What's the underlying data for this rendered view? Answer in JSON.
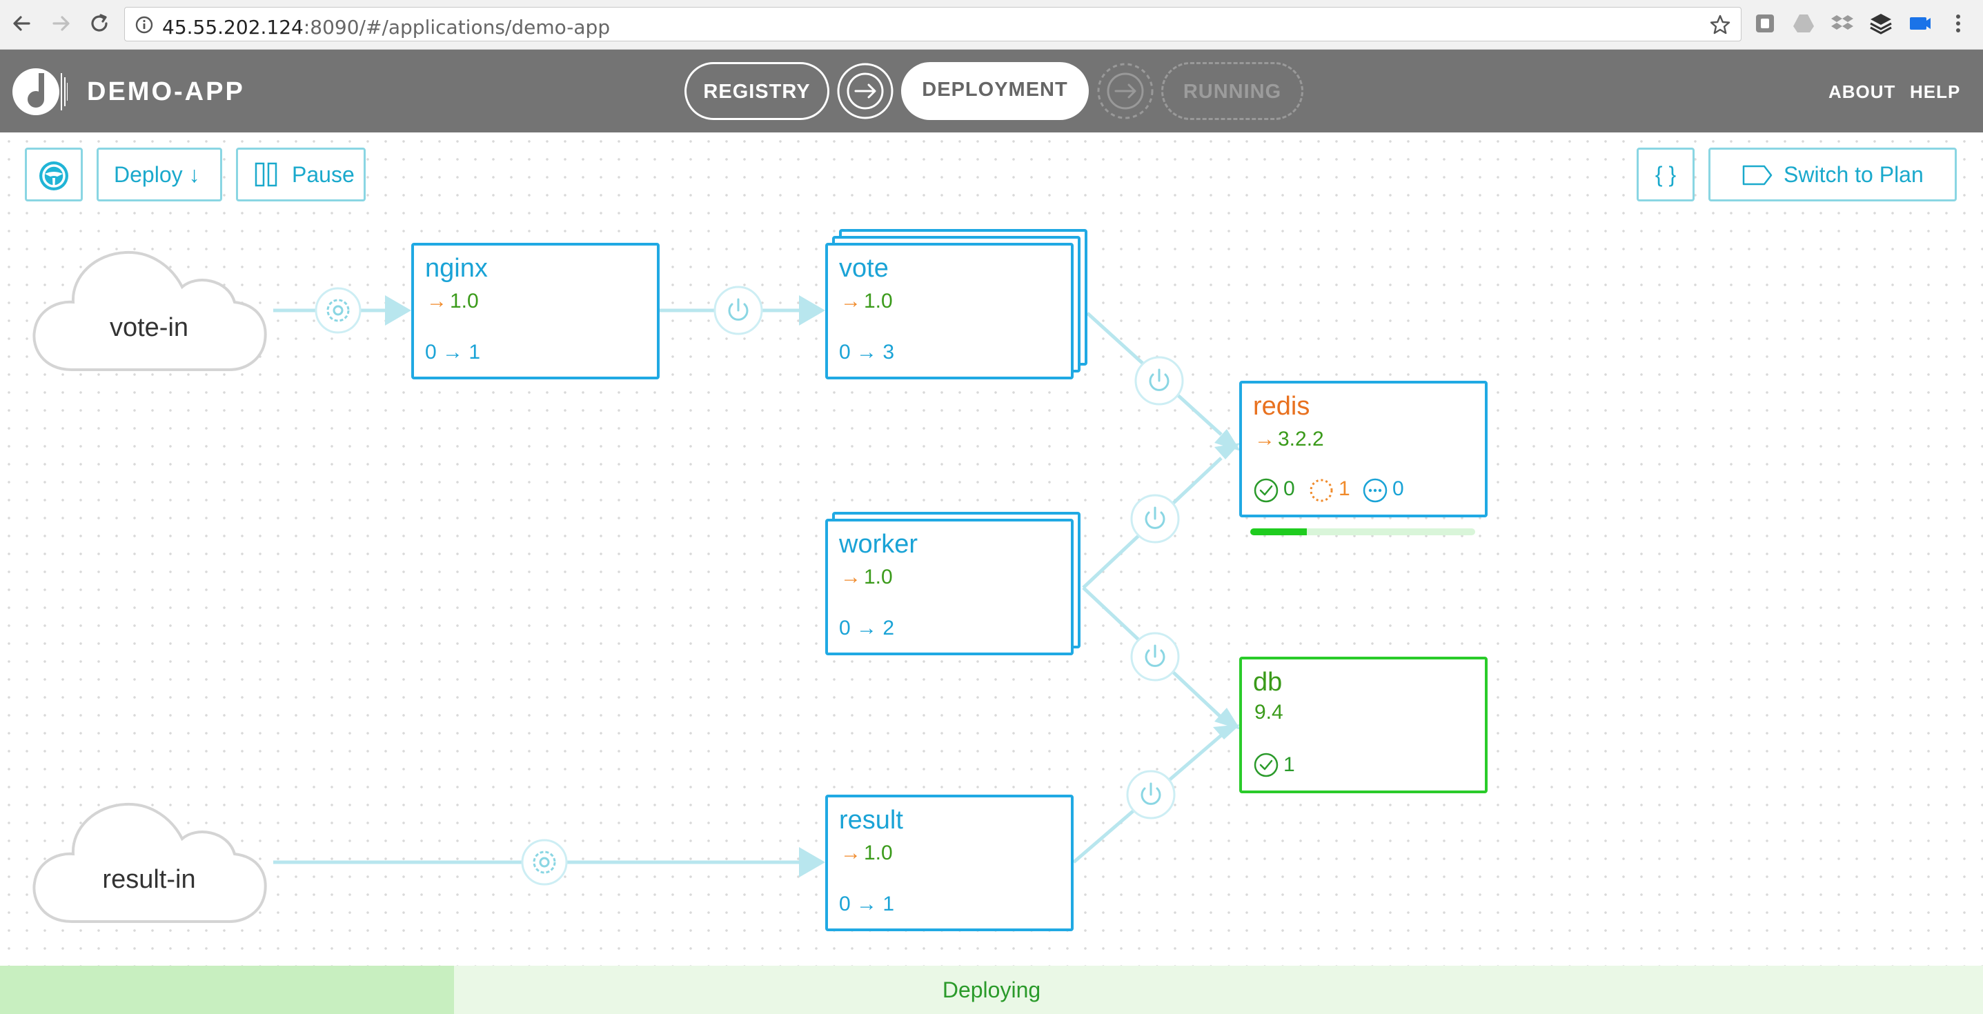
{
  "browser": {
    "url_host": "45.55.202.124",
    "url_rest": ":8090/#/applications/demo-app"
  },
  "header": {
    "app_title": "DEMO-APP",
    "steps": [
      {
        "label": "REGISTRY",
        "state": "done"
      },
      {
        "label": "DEPLOYMENT",
        "state": "active"
      },
      {
        "label": "RUNNING",
        "state": "pending"
      }
    ],
    "nav": {
      "about": "ABOUT",
      "help": "HELP"
    }
  },
  "toolbar": {
    "deploy_label": "Deploy ↓",
    "pause_label": "Pause",
    "json_label": "{ }",
    "switch_label": "Switch to Plan"
  },
  "sources": [
    {
      "id": "vote-in",
      "label": "vote-in"
    },
    {
      "id": "result-in",
      "label": "result-in"
    }
  ],
  "nodes": {
    "nginx": {
      "name": "nginx",
      "version": "1.0",
      "arrow": "→",
      "count": "0 → 1"
    },
    "vote": {
      "name": "vote",
      "version": "1.0",
      "arrow": "→",
      "count": "0 → 3"
    },
    "worker": {
      "name": "worker",
      "version": "1.0",
      "arrow": "→",
      "count": "0 → 2"
    },
    "result": {
      "name": "result",
      "version": "1.0",
      "arrow": "→",
      "count": "0 → 1"
    },
    "redis": {
      "name": "redis",
      "version": "3.2.2",
      "arrow": "→",
      "ok": "0",
      "starting": "1",
      "pending": "0",
      "progress": 0.25
    },
    "db": {
      "name": "db",
      "version": "9.4",
      "ok": "1"
    }
  },
  "colors": {
    "accent": "#20a9e3",
    "link": "#b8e6ee",
    "ok_green": "#22c622",
    "version_green": "#3a9a1a",
    "orange": "#f08a2a",
    "header_bg": "#747474"
  },
  "status": {
    "text": "Deploying",
    "progress": 0.229
  }
}
